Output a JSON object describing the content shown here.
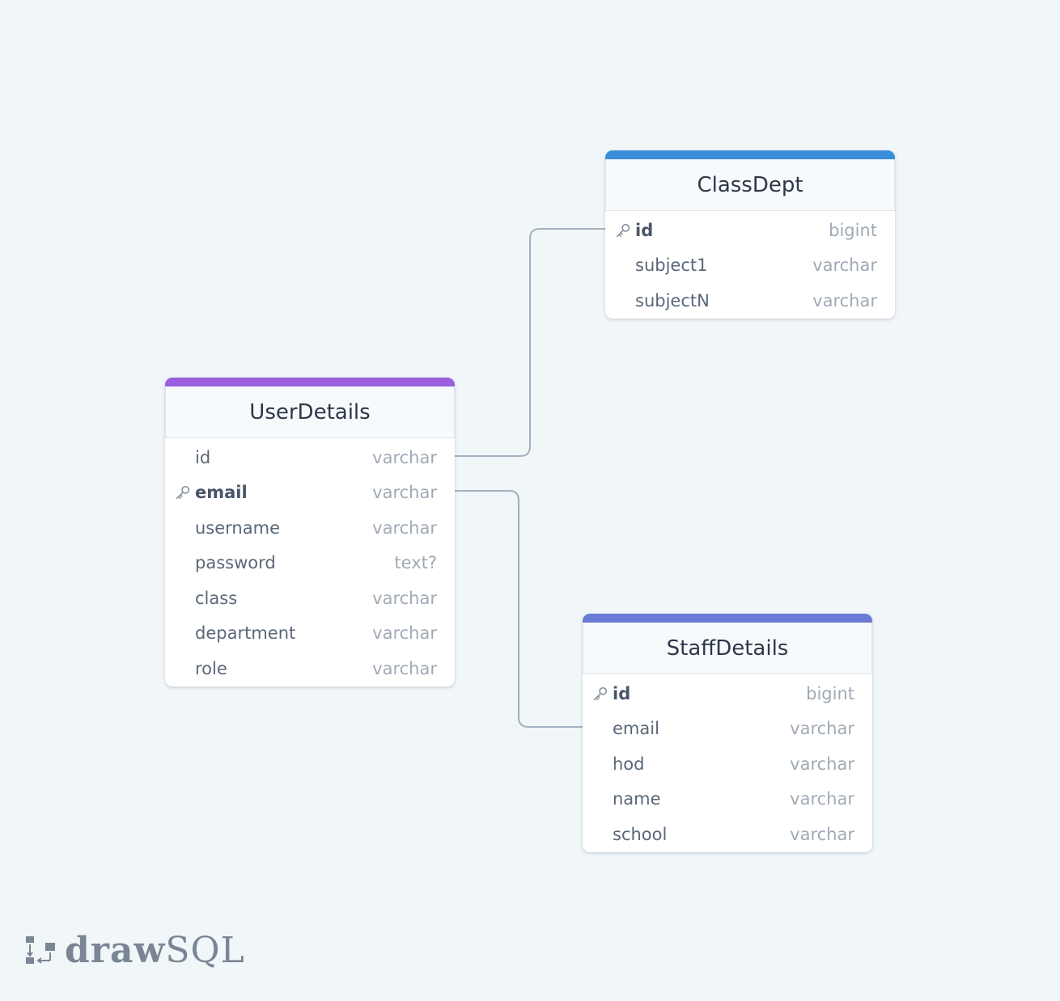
{
  "tables": {
    "classdept": {
      "title": "ClassDept",
      "accent": "#3b8fd9",
      "columns": [
        {
          "name": "id",
          "type": "bigint",
          "pk": true
        },
        {
          "name": "subject1",
          "type": "varchar",
          "pk": false
        },
        {
          "name": "subjectN",
          "type": "varchar",
          "pk": false
        }
      ]
    },
    "userdetails": {
      "title": "UserDetails",
      "accent": "#9b5fe0",
      "columns": [
        {
          "name": "id",
          "type": "varchar",
          "pk": false
        },
        {
          "name": "email",
          "type": "varchar",
          "pk": true
        },
        {
          "name": "username",
          "type": "varchar",
          "pk": false
        },
        {
          "name": "password",
          "type": "text?",
          "pk": false
        },
        {
          "name": "class",
          "type": "varchar",
          "pk": false
        },
        {
          "name": "department",
          "type": "varchar",
          "pk": false
        },
        {
          "name": "role",
          "type": "varchar",
          "pk": false
        }
      ]
    },
    "staffdetails": {
      "title": "StaffDetails",
      "accent": "#6b7ad4",
      "columns": [
        {
          "name": "id",
          "type": "bigint",
          "pk": true
        },
        {
          "name": "email",
          "type": "varchar",
          "pk": false
        },
        {
          "name": "hod",
          "type": "varchar",
          "pk": false
        },
        {
          "name": "name",
          "type": "varchar",
          "pk": false
        },
        {
          "name": "school",
          "type": "varchar",
          "pk": false
        }
      ]
    }
  },
  "relations": [
    {
      "from": "userdetails.id",
      "to": "classdept.id"
    },
    {
      "from": "userdetails.email",
      "to": "staffdetails.id"
    }
  ],
  "brand": {
    "bold": "draw",
    "light": "SQL",
    "icon": "drawsql-logo-icon"
  },
  "colors": {
    "background": "#f1f6f9",
    "connector": "#a3b0bf"
  }
}
